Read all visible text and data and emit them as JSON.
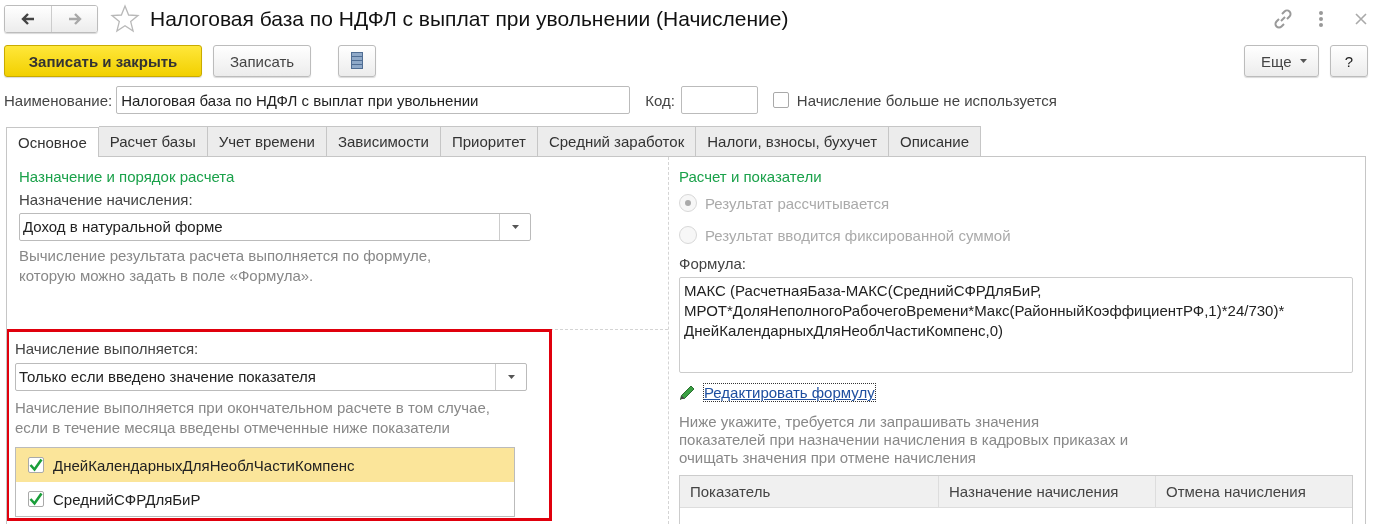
{
  "window": {
    "title": "Налоговая база по НДФЛ с выплат при увольнении (Начисление)",
    "favorite": false,
    "nav": [
      {
        "kind": "back",
        "disabled": false
      },
      {
        "kind": "forward",
        "disabled": true
      }
    ]
  },
  "toolbar": {
    "buttons": [
      {
        "kind": "primary",
        "label": "Записать и закрыть"
      },
      {
        "kind": "default",
        "label": "Записать"
      },
      {
        "kind": "list"
      }
    ],
    "right_buttons": [
      {
        "kind": "dropdown",
        "label": "Еще"
      },
      {
        "kind": "default",
        "label": "?"
      }
    ]
  },
  "header_fields": {
    "name_label": "Наименование:",
    "name_value": "Налоговая база по НДФЛ с выплат при увольнении",
    "code_label": "Код:",
    "unused": {
      "label": "Начисление больше не используется",
      "checked": false
    }
  },
  "tabs": [
    {
      "label": "Основное",
      "selected": true
    },
    {
      "label": "Расчет базы",
      "selected": false
    },
    {
      "label": "Учет времени",
      "selected": false
    },
    {
      "label": "Зависимости",
      "selected": false
    },
    {
      "label": "Приоритет",
      "selected": false
    },
    {
      "label": "Средний заработок",
      "selected": false
    },
    {
      "label": "Налоги, взносы, бухучет",
      "selected": false
    },
    {
      "label": "Описание",
      "selected": false
    }
  ],
  "left": {
    "heading": "Назначение и порядок расчета",
    "purpose_label": "Назначение начисления:",
    "purpose_value": "Доход в натуральной форме",
    "purpose_hint": "Вычисление результата расчета выполняется по формуле,\nкоторую можно задать в поле «Формула».",
    "condition_label": "Начисление выполняется:",
    "condition_value": "Только если введено значение показателя",
    "condition_hint": "Начисление выполняется при окончательном расчете в том случае,\nесли в течение месяца введены отмеченные ниже показатели",
    "indicators": [
      {
        "label": "ДнейКалендарныхДляНеоблЧастиКомпенс",
        "checked": true,
        "selected": true
      },
      {
        "label": "СреднийСФРДляБиР",
        "checked": true,
        "selected": false
      }
    ]
  },
  "right": {
    "heading": "Расчет и показатели",
    "radios": [
      {
        "label": "Результат рассчитывается",
        "selected": true,
        "disabled": true
      },
      {
        "label": "Результат вводится фиксированной суммой",
        "selected": false,
        "disabled": true
      }
    ],
    "formula_label": "Формула:",
    "formula": "МАКС (РасчетнаяБаза-МАКС(СреднийСФРДляБиР,\nМРОТ*ДоляНеполногоРабочегоВремени*Макс(РайонныйКоэффициентРФ,1)*24/730)*\nДнейКалендарныхДляНеоблЧастиКомпенс,0)",
    "edit_link": "Редактировать формулу",
    "hint": "Ниже укажите, требуется ли запрашивать значения\nпоказателей при назначении начисления в кадровых приказах и\nочищать значения при отмене начисления",
    "table": {
      "columns": [
        "Показатель",
        "Назначение начисления",
        "Отмена начисления"
      ]
    }
  }
}
